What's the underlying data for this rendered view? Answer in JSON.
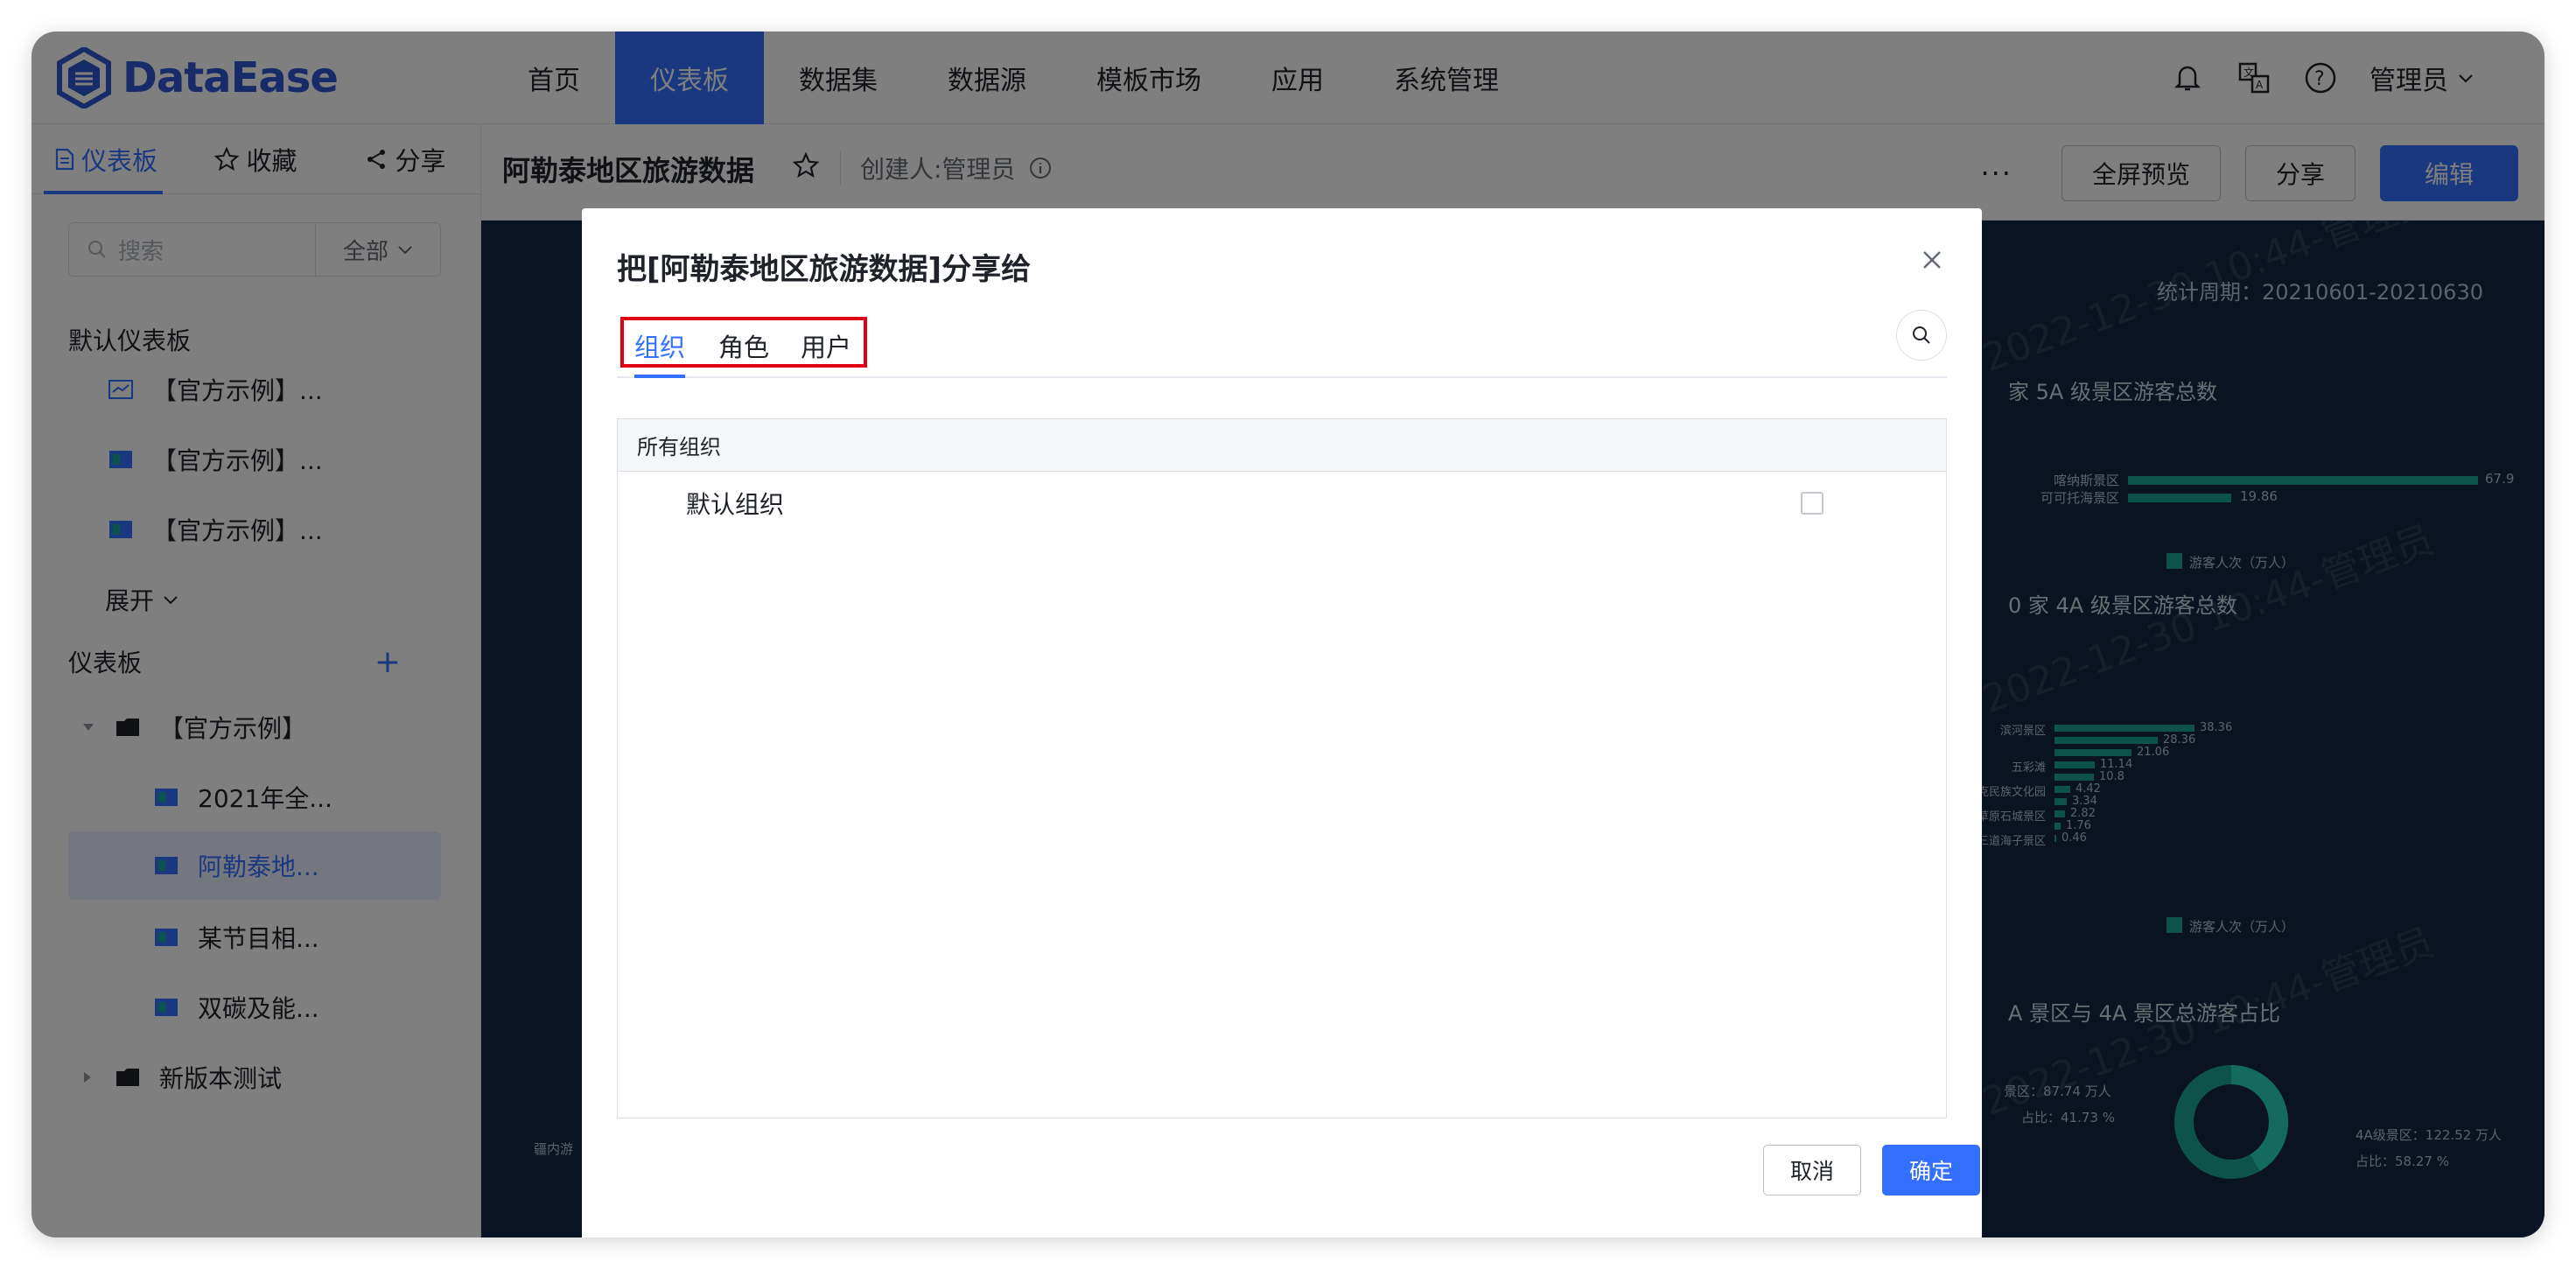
{
  "app": {
    "logo_text": "DataEase"
  },
  "nav": {
    "items": [
      "首页",
      "仪表板",
      "数据集",
      "数据源",
      "模板市场",
      "应用",
      "系统管理"
    ],
    "active": "仪表板",
    "user": "管理员"
  },
  "sidebar": {
    "tabs": [
      "仪表板",
      "收藏",
      "分享"
    ],
    "search_placeholder": "搜索",
    "filter_value": "全部",
    "default_section": "默认仪表板",
    "default_items": [
      "【官方示例】...",
      "【官方示例】...",
      "【官方示例】..."
    ],
    "expand_label": "展开",
    "dashboards_section": "仪表板",
    "folder": "【官方示例】",
    "folder_items": [
      "2021年全...",
      "阿勒泰地...",
      "某节目相...",
      "双碳及能..."
    ],
    "folder2": "新版本测试"
  },
  "dashboard_header": {
    "title": "阿勒泰地区旅游数据",
    "creator": "创建人:管理员",
    "buttons": {
      "fullscreen": "全屏预览",
      "share": "分享",
      "edit": "编辑"
    },
    "more": "···"
  },
  "dashboard_bg": {
    "period": "统计周期：20210601-20210630",
    "chart1_title": "家 5A 级景区游客总数",
    "chart1_rows": [
      {
        "label": "喀纳斯景区",
        "value": "67.9"
      },
      {
        "label": "可可托海景区",
        "value": "19.86"
      }
    ],
    "chart2_title": "0 家 4A 级景区游客总数",
    "chart2_rows": [
      {
        "label": "滨河景区",
        "value": "38.36"
      },
      {
        "label": "",
        "value": "28.36"
      },
      {
        "label": "",
        "value": "21.06"
      },
      {
        "label": "五彩滩",
        "value": "11.14"
      },
      {
        "label": "",
        "value": "10.8"
      },
      {
        "label": "草原石人哈萨克民族文化园",
        "value": "4.42"
      },
      {
        "label": "",
        "value": "3.34"
      },
      {
        "label": "草原石城景区",
        "value": "2.82"
      },
      {
        "label": "",
        "value": "1.76"
      },
      {
        "label": "三道海子景区",
        "value": "0.46"
      }
    ],
    "legend": "游客人次（万人）",
    "chart3_title": "A 景区与 4A 景区总游客占比",
    "chart3_left": [
      "景区：87.74 万人",
      "占比：41.73 %"
    ],
    "chart3_right": [
      "4A级景区：122.52 万人",
      "占比：58.27 %"
    ],
    "watermark": "2022-12-30 10:44-管理员",
    "left_stub": "疆内游"
  },
  "modal": {
    "title": "把[阿勒泰地区旅游数据]分享给",
    "tabs": [
      "组织",
      "角色",
      "用户"
    ],
    "active_tab": "组织",
    "tree_header": "所有组织",
    "tree_items": [
      {
        "label": "默认组织",
        "checked": false
      }
    ],
    "cancel": "取消",
    "confirm": "确定"
  },
  "colors": {
    "primary": "#3370ff",
    "highlight": "#e00014",
    "teal": "#1aa596",
    "dash_bg": "#132744"
  }
}
